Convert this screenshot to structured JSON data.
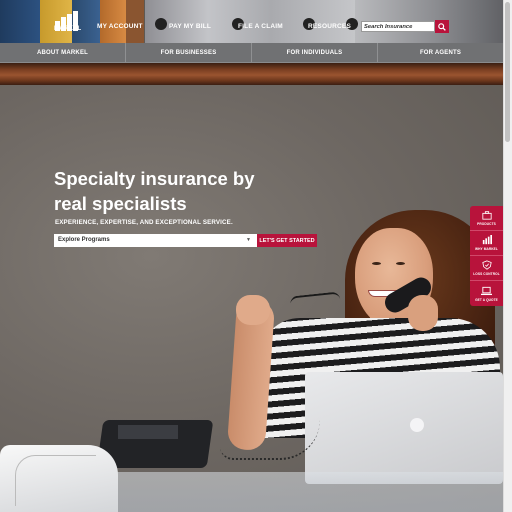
{
  "brand": {
    "logo_text": "MARKEL",
    "accent": "#b8133b"
  },
  "utility_nav": {
    "my_account": "MY ACCOUNT",
    "pay_my_bill": "PAY MY BILL",
    "file_a_claim": "FILE A CLAIM",
    "resources": "RESOURCES"
  },
  "search": {
    "placeholder": "Search Insurance",
    "icon": "search-icon"
  },
  "main_nav": {
    "tabs": [
      {
        "label": "ABOUT MARKEL"
      },
      {
        "label": "FOR BUSINESSES"
      },
      {
        "label": "FOR INDIVIDUALS"
      },
      {
        "label": "FOR AGENTS"
      }
    ]
  },
  "hero": {
    "headline_line1": "Specialty insurance by",
    "headline_line2": "real specialists",
    "subheadline": "EXPERIENCE, EXPERTISE, AND EXCEPTIONAL SERVICE.",
    "select_value": "Explore Programs",
    "cta_label": "LET'S GET STARTED"
  },
  "quick_rail": {
    "items": [
      {
        "label": "PRODUCTS",
        "icon": "briefcase-icon"
      },
      {
        "label": "WHY MARKEL",
        "icon": "building-icon"
      },
      {
        "label": "LOSS CONTROL",
        "icon": "shield-icon"
      },
      {
        "label": "GET A QUOTE",
        "icon": "laptop-icon"
      }
    ]
  }
}
